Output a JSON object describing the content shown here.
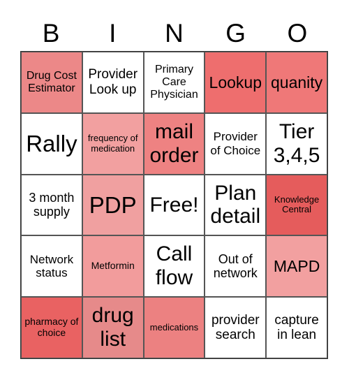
{
  "header": {
    "letters": [
      "B",
      "I",
      "N",
      "G",
      "O"
    ]
  },
  "cells": [
    {
      "text": "Drug Cost Estimator",
      "bg": "#EC8888",
      "size": 16
    },
    {
      "text": "Provider Look up",
      "bg": "#FFFFFF",
      "size": 19
    },
    {
      "text": "Primary Care Physician",
      "bg": "#FFFFFF",
      "size": 16
    },
    {
      "text": "Lookup",
      "bg": "#EE6E6E",
      "size": 23
    },
    {
      "text": "quanity",
      "bg": "#EF7878",
      "size": 23
    },
    {
      "text": "Rally",
      "bg": "#FFFFFF",
      "size": 33
    },
    {
      "text": "frequency of medication",
      "bg": "#F2A0A0",
      "size": 13
    },
    {
      "text": "mail order",
      "bg": "#EE8282",
      "size": 30
    },
    {
      "text": "Provider of Choice",
      "bg": "#FFFFFF",
      "size": 17
    },
    {
      "text": "Tier 3,4,5",
      "bg": "#FFFFFF",
      "size": 30
    },
    {
      "text": "3 month supply",
      "bg": "#FFFFFF",
      "size": 18
    },
    {
      "text": "PDP",
      "bg": "#F0A0A0",
      "size": 33
    },
    {
      "text": "Free!",
      "bg": "#FFFFFF",
      "size": 30
    },
    {
      "text": "Plan detail",
      "bg": "#FFFFFF",
      "size": 30
    },
    {
      "text": "Knowledge Central",
      "bg": "#E55C5C",
      "size": 13
    },
    {
      "text": "Network status",
      "bg": "#FFFFFF",
      "size": 17
    },
    {
      "text": "Metformin",
      "bg": "#F29C9C",
      "size": 14
    },
    {
      "text": "Call flow",
      "bg": "#FFFFFF",
      "size": 30
    },
    {
      "text": "Out of network",
      "bg": "#FFFFFF",
      "size": 18
    },
    {
      "text": "MAPD",
      "bg": "#F2A0A0",
      "size": 23
    },
    {
      "text": "pharmacy of choice",
      "bg": "#E96262",
      "size": 14
    },
    {
      "text": "drug list",
      "bg": "#E68A8A",
      "size": 30
    },
    {
      "text": "medications",
      "bg": "#EC8181",
      "size": 13
    },
    {
      "text": "provider search",
      "bg": "#FFFFFF",
      "size": 19
    },
    {
      "text": "capture in lean",
      "bg": "#FFFFFF",
      "size": 19
    }
  ]
}
